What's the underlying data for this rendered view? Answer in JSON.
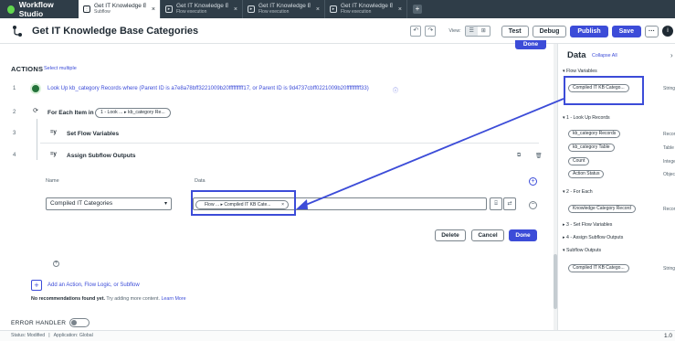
{
  "app": {
    "brand": "Workflow Studio",
    "colors": {
      "accent": "#3c4cd8",
      "topbar": "#2f3d48",
      "success": "#24733a"
    }
  },
  "tabs": [
    {
      "title": "Get IT Knowledge Base",
      "subtitle": "Subflow",
      "icon": "subflow-icon"
    },
    {
      "title": "Get IT Knowledge Base",
      "subtitle": "Flow execution",
      "icon": "execution-icon"
    },
    {
      "title": "Get IT Knowledge Base",
      "subtitle": "Flow execution",
      "icon": "execution-icon"
    },
    {
      "title": "Get IT Knowledge Base",
      "subtitle": "Flow execution",
      "icon": "execution-icon"
    }
  ],
  "header": {
    "title": "Get IT Knowledge Base Categories",
    "view_label": "View:",
    "buttons": {
      "test": "Test",
      "debug": "Debug",
      "publish": "Publish",
      "save": "Save",
      "more": "···"
    }
  },
  "main": {
    "done_top": "Done",
    "actions_label": "ACTIONS",
    "select_multiple": "Select multiple",
    "steps": [
      {
        "num": "1",
        "text": "Look Up kb_category Records where (Parent ID is a7e8a78bff3221009b20ffffffffff17, or Parent ID is 9d4737cbff0221009b20ffffffffff33)"
      },
      {
        "num": "2",
        "text": "For Each Item in",
        "pill": "1 - Look ...   ▸ kb_category Re..."
      },
      {
        "num": "3",
        "text": "Set Flow Variables"
      },
      {
        "num": "4",
        "text": "Assign Subflow Outputs"
      }
    ],
    "assign": {
      "col_name": "Name",
      "col_data": "Data",
      "name_value": "Compiled IT Categories",
      "data_pill": "Flow ...  ▸ Compiled IT KB Cate...",
      "buttons": {
        "delete": "Delete",
        "cancel": "Cancel",
        "done": "Done"
      }
    },
    "add_action": "Add an Action, Flow Logic, or Subflow",
    "no_recs_bold": "No recommendations found yet.",
    "no_recs": " Try adding more content. ",
    "learn_more": "Learn More",
    "error_handler": "ERROR HANDLER"
  },
  "status": {
    "status": "Status: Modified",
    "application": "Application: Global",
    "version": "1.0"
  },
  "data_panel": {
    "title": "Data",
    "collapse": "Collapse All",
    "sections": [
      {
        "label": "▾ Flow Variables"
      },
      {
        "label": "▾ 1 - Look Up Records"
      },
      {
        "label": "▾ 2 - For Each"
      },
      {
        "label": "▸ 3 - Set Flow Variables"
      },
      {
        "label": "▸ 4 - Assign Subflow Outputs"
      },
      {
        "label": "▾ Subflow Outputs"
      }
    ],
    "items": [
      {
        "pill": "Compiled IT KB Catego...",
        "type": "String"
      },
      {
        "pill": "kb_category Records",
        "type": "Records"
      },
      {
        "pill": "kb_category Table",
        "type": "Table"
      },
      {
        "pill": "Count",
        "type": "Integer"
      },
      {
        "pill": "Action Status",
        "type": "Object"
      },
      {
        "pill": "Knowledge Category Record",
        "type": "Records"
      },
      {
        "pill": "Compiled IT KB Catego...",
        "type": "String"
      }
    ]
  }
}
